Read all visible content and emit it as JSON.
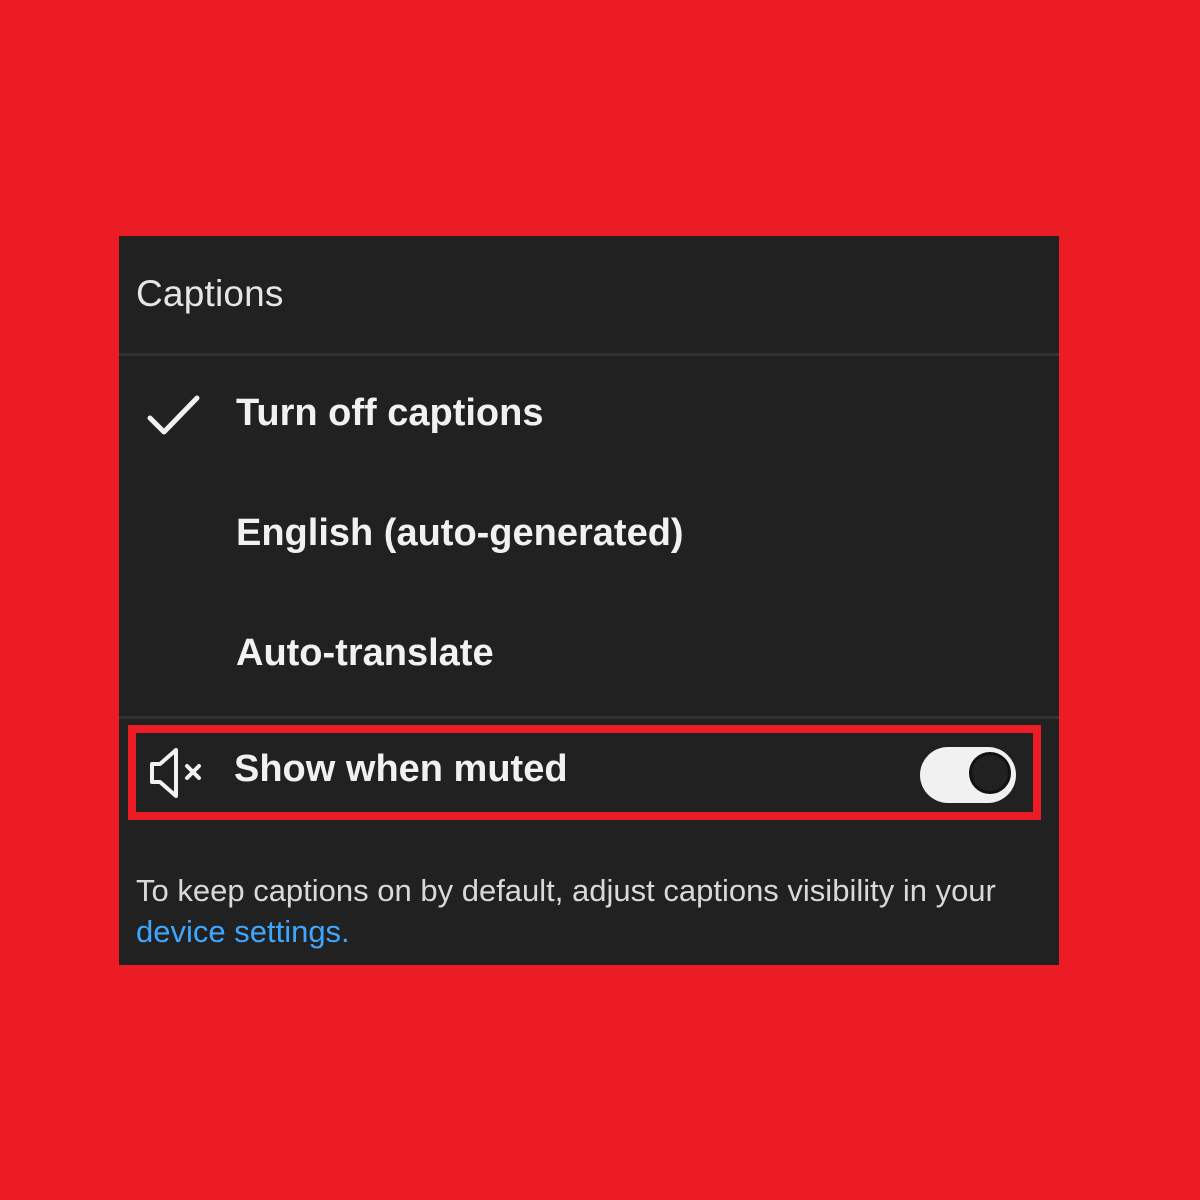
{
  "captions_menu": {
    "title": "Captions",
    "options": [
      {
        "label": "Turn off captions",
        "selected": true
      },
      {
        "label": "English (auto-generated)",
        "selected": false
      },
      {
        "label": "Auto-translate",
        "selected": false
      }
    ],
    "show_when_muted": {
      "label": "Show when muted",
      "icon": "muted-speaker-icon",
      "enabled": true
    },
    "footnote": {
      "text_before": "To keep captions on by default, adjust captions visibility in your ",
      "link": "device settings."
    }
  },
  "colors": {
    "background": "#ec1c24",
    "panel": "#212121",
    "highlight_border": "#ec1c24",
    "link": "#3ea6ff"
  }
}
